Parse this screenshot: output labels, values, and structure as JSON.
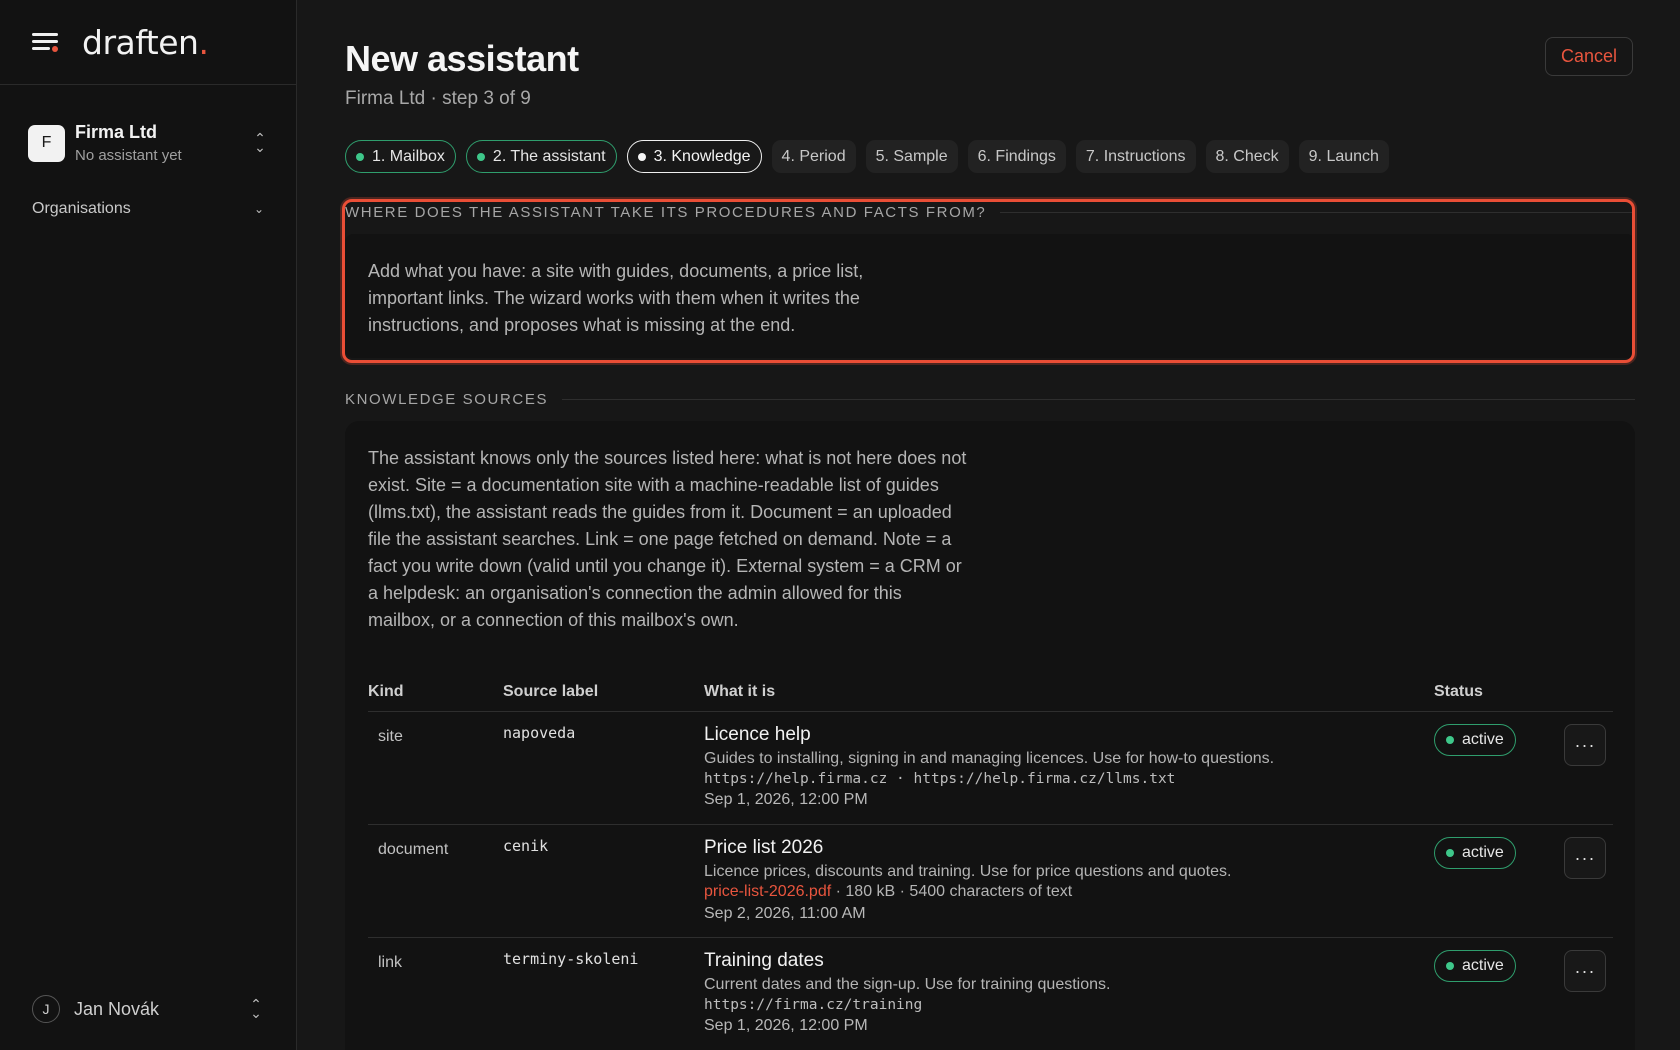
{
  "sidebar": {
    "logo_text": "draften",
    "logo_dot": ".",
    "org": {
      "initial": "F",
      "name": "Firma Ltd",
      "subtitle": "No assistant yet"
    },
    "organisations_label": "Organisations",
    "user": {
      "initial": "J",
      "name": "Jan Novák"
    }
  },
  "header": {
    "title": "New assistant",
    "subtitle": "Firma Ltd · step 3 of 9",
    "cancel_label": "Cancel"
  },
  "steps": [
    {
      "label": "1. Mailbox",
      "state": "done"
    },
    {
      "label": "2. The assistant",
      "state": "done"
    },
    {
      "label": "3. Knowledge",
      "state": "current"
    },
    {
      "label": "4. Period",
      "state": "upcoming"
    },
    {
      "label": "5. Sample",
      "state": "upcoming"
    },
    {
      "label": "6. Findings",
      "state": "upcoming"
    },
    {
      "label": "7. Instructions",
      "state": "upcoming"
    },
    {
      "label": "8. Check",
      "state": "upcoming"
    },
    {
      "label": "9. Launch",
      "state": "upcoming"
    }
  ],
  "intro_section": {
    "heading": "WHERE DOES THE ASSISTANT TAKE ITS PROCEDURES AND FACTS FROM?",
    "text": "Add what you have: a site with guides, documents, a price list, important links. The wizard works with them when it writes the instructions, and proposes what is missing at the end."
  },
  "knowledge_section": {
    "heading": "KNOWLEDGE SOURCES",
    "text": "The assistant knows only the sources listed here: what is not here does not exist. Site = a documentation site with a machine-readable list of guides (llms.txt), the assistant reads the guides from it. Document = an uploaded file the assistant searches. Link = one page fetched on demand. Note = a fact you write down (valid until you change it). External system = a CRM or a helpdesk: an organisation's connection the admin allowed for this mailbox, or a connection of this mailbox's own.",
    "columns": {
      "kind": "Kind",
      "label": "Source label",
      "what": "What it is",
      "status": "Status"
    },
    "rows": [
      {
        "kind": "site",
        "label": "napoveda",
        "title": "Licence help",
        "desc": "Guides to installing, signing in and managing licences. Use for how-to questions.",
        "mono": "https://help.firma.cz · https://help.firma.cz/llms.txt",
        "date": "Sep 1, 2026, 12:00 PM",
        "status": "active"
      },
      {
        "kind": "document",
        "label": "cenik",
        "title": "Price list 2026",
        "desc": "Licence prices, discounts and training. Use for price questions and quotes.",
        "file": "price-list-2026.pdf",
        "file_meta": " · 180 kB · 5400 characters of text",
        "date": "Sep 2, 2026, 11:00 AM",
        "status": "active"
      },
      {
        "kind": "link",
        "label": "terminy-skoleni",
        "title": "Training dates",
        "desc": "Current dates and the sign-up. Use for training questions.",
        "mono": "https://firma.cz/training",
        "date": "Sep 1, 2026, 12:00 PM",
        "status": "active"
      }
    ],
    "more_label": "···"
  },
  "colors": {
    "accent": "#e8553e",
    "success": "#3ec78a",
    "background": "#171717"
  }
}
